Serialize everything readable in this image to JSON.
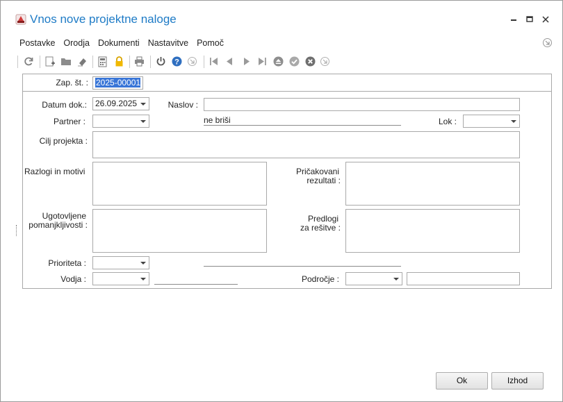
{
  "window": {
    "title": "Vnos nove projektne naloge"
  },
  "menu": [
    {
      "label": "Postavke"
    },
    {
      "label": "Orodja"
    },
    {
      "label": "Dokumenti"
    },
    {
      "label": "Nastavitve"
    },
    {
      "label": "Pomoč"
    }
  ],
  "form": {
    "zap_st": {
      "label": "Zap. št. :",
      "value": "2025-00001"
    },
    "datum": {
      "label": "Datum dok.:",
      "value": "26.09.2025"
    },
    "naslov": {
      "label": "Naslov :",
      "value": ""
    },
    "partner": {
      "label": "Partner :",
      "value": "",
      "note": "ne briši"
    },
    "lok": {
      "label": "Lok :",
      "value": ""
    },
    "cilj": {
      "label": "Cilj projekta :"
    },
    "razlogi": {
      "label": "Razlogi in motivi :"
    },
    "pricakovani": {
      "label_1": "Pričakovani",
      "label_2": "rezultati :"
    },
    "ugotovljene": {
      "label_1": "Ugotovljene",
      "label_2": "pomanjkljivosti :"
    },
    "predlogi": {
      "label_1": "Predlogi",
      "label_2": "za rešitve :"
    },
    "prioriteta": {
      "label": "Prioriteta :",
      "value": ""
    },
    "vodja": {
      "label": "Vodja :",
      "value": ""
    },
    "podrocje": {
      "label": "Področje :",
      "value": ""
    }
  },
  "buttons": {
    "ok": "Ok",
    "exit": "Izhod"
  },
  "colors": {
    "title": "#1e7bc6",
    "selection": "#3875d7",
    "help_icon": "#2f6fc0"
  }
}
